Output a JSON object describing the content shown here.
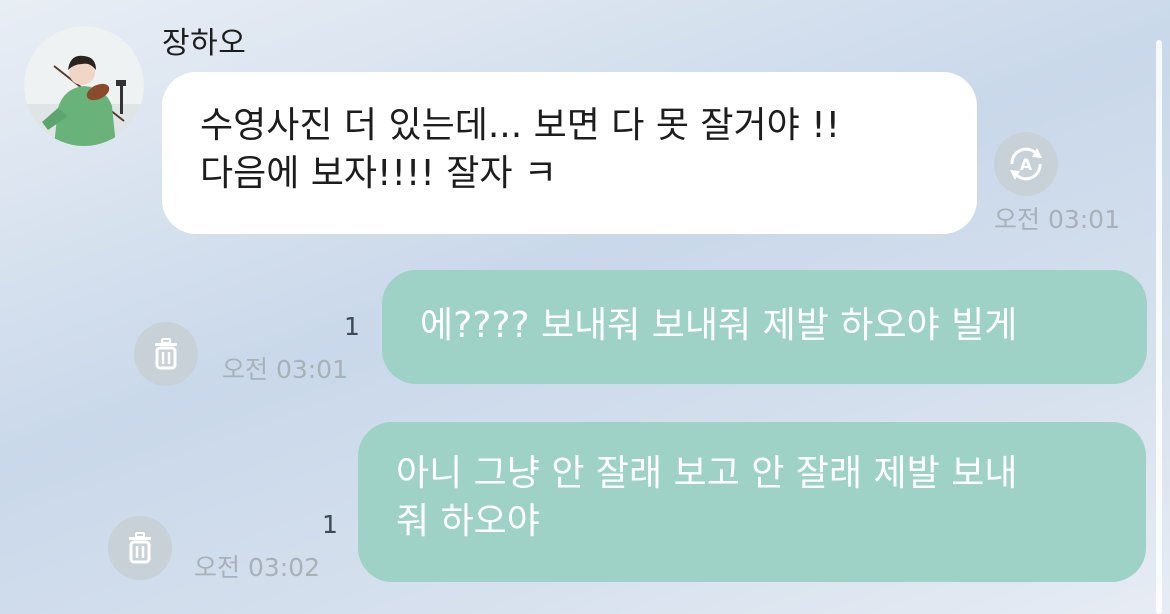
{
  "chat": {
    "sender_name": "장하오",
    "avatar_icon": "profile-photo-violinist",
    "messages": [
      {
        "direction": "incoming",
        "text": "수영사진 더 있는데... 보면 다 못 잘거야 !!\n다음에 보자!!!! 잘자 ㅋ",
        "time": "오전 03:01",
        "side_icon": "translate-icon"
      },
      {
        "direction": "outgoing",
        "text": "에???? 보내줘 보내줘 제발 하오야 빌게",
        "time": "오전 03:01",
        "unread": "1",
        "side_icon": "trash-icon"
      },
      {
        "direction": "outgoing",
        "text": "아니 그냥 안 잘래 보고 안 잘래 제발 보내\n줘 하오야",
        "time": "오전 03:02",
        "unread": "1",
        "side_icon": "trash-icon"
      }
    ]
  },
  "colors": {
    "outgoing_bubble": "#9fd2c7",
    "incoming_bubble": "#ffffff",
    "meta_text": "#a8b0b8",
    "icon_circle": "#c8d0d8"
  }
}
